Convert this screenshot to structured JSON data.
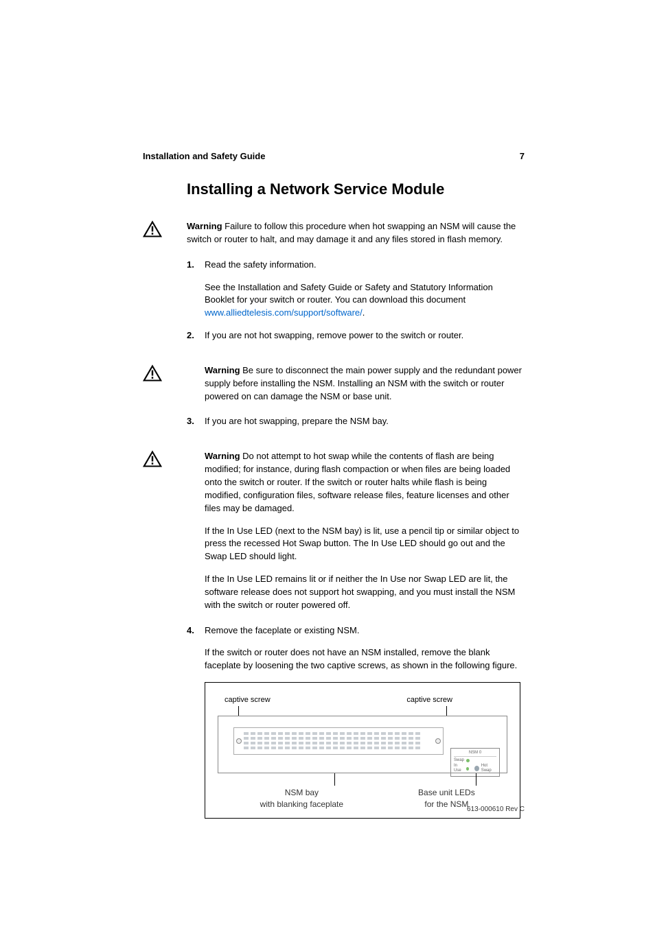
{
  "header": {
    "title": "Installation and Safety Guide",
    "page_number": "7"
  },
  "section_title": "Installing a Network Service Module",
  "warnings": {
    "intro": {
      "label": "Warning",
      "text": " Failure to follow this procedure when hot swapping an NSM will cause the switch or router to halt, and may damage it and any files stored in flash memory."
    },
    "power": {
      "label": "Warning",
      "text": " Be sure to disconnect the main power supply and the redundant power supply before installing the NSM. Installing an NSM with the switch or router powered on can damage the NSM or base unit."
    },
    "flash": {
      "label": "Warning",
      "text": " Do not attempt to hot swap while the contents of flash are being modified; for instance, during flash compaction or when files are being loaded onto the switch or router. If the switch or router halts while flash is being modified, configuration files, software release files, feature licenses and other files may be damaged."
    }
  },
  "steps": {
    "s1": {
      "num": "1.",
      "title": "Read the safety information.",
      "p1": "See the Installation and Safety Guide or Safety and Statutory Information Booklet for your switch or router. You can download this document ",
      "link": "www.alliedtelesis.com/support/software/",
      "p1_tail": "."
    },
    "s2": {
      "num": "2.",
      "title": "If you are not hot swapping, remove power to the switch or router."
    },
    "s3": {
      "num": "3.",
      "title": "If you are hot swapping, prepare the NSM bay.",
      "p_after_warn_1": "If the In Use LED (next to the NSM bay) is lit, use a pencil tip or similar object to press the recessed Hot Swap button. The In Use LED should go out and the Swap LED should light.",
      "p_after_warn_2": "If the In Use LED remains lit or if neither the In Use nor Swap LED are lit, the software release does not support hot swapping, and you must install the NSM with the switch or router powered off."
    },
    "s4": {
      "num": "4.",
      "title": "Remove the faceplate or existing NSM.",
      "p1": "If the switch or router does not have an NSM installed, remove the blank faceplate by loosening the two captive screws, as shown in the following figure."
    }
  },
  "figure": {
    "captive_screw_left": "captive screw",
    "captive_screw_right": "captive screw",
    "led_panel_title": "NSM 0",
    "led_swap": "Swap",
    "led_inuse": "In Use",
    "led_hotswap": "Hot Swap",
    "nsm_bay_line1": "NSM bay",
    "nsm_bay_line2": "with blanking faceplate",
    "base_leds_line1": "Base unit LEDs",
    "base_leds_line2": "for the NSM"
  },
  "footer": "613-000610 Rev C"
}
